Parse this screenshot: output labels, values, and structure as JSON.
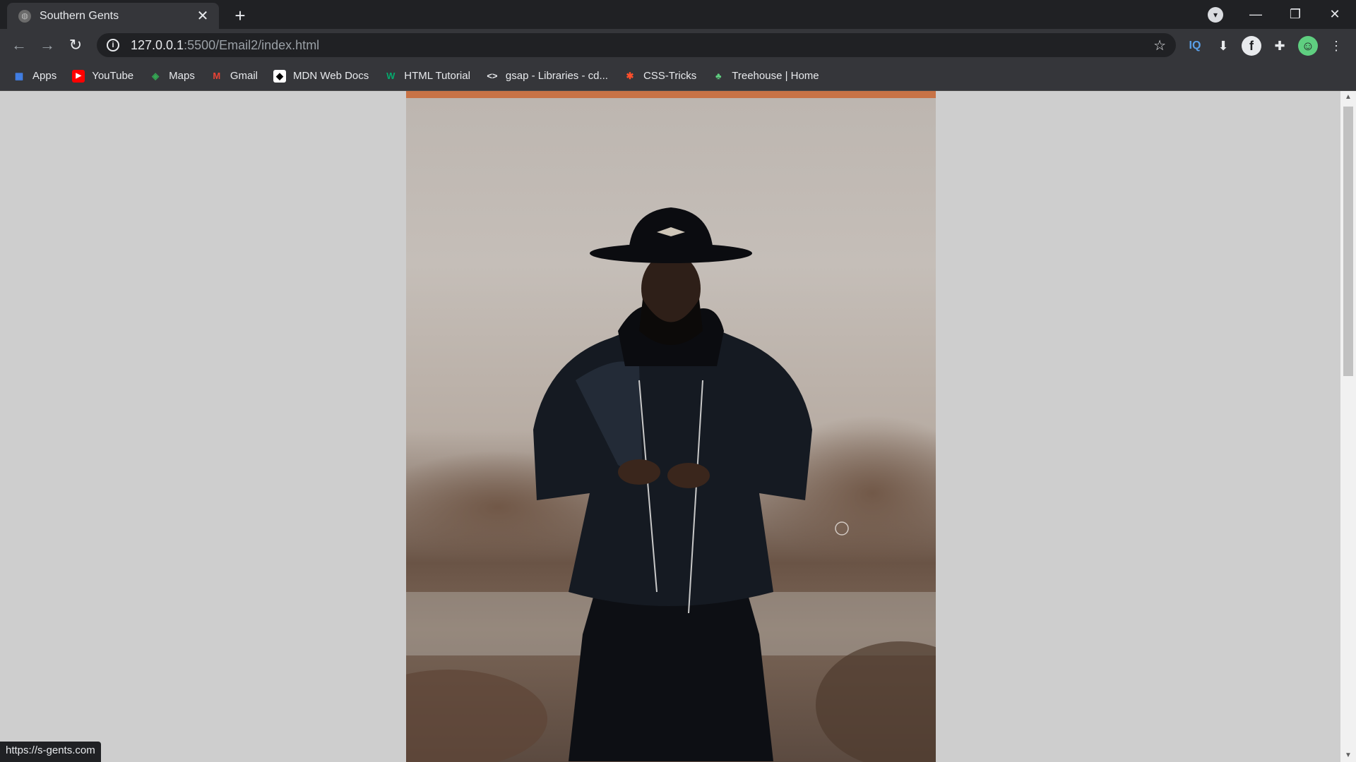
{
  "tab": {
    "title": "Southern Gents",
    "close": "✕"
  },
  "new_tab": "+",
  "window": {
    "minimize": "—",
    "restore": "❐",
    "close": "✕"
  },
  "nav": {
    "back": "←",
    "forward": "→",
    "reload": "↻"
  },
  "address": {
    "host": "127.0.0.1",
    "path": ":5500/Email2/index.html"
  },
  "extensions": {
    "iq": "IQ"
  },
  "bookmarks": [
    {
      "label": "Apps",
      "icon": "apps-grid-icon",
      "color": "#4285f4"
    },
    {
      "label": "YouTube",
      "icon": "youtube-icon",
      "color": "#ff0000"
    },
    {
      "label": "Maps",
      "icon": "maps-icon",
      "color": "#34a853"
    },
    {
      "label": "Gmail",
      "icon": "gmail-icon",
      "color": "#ea4335"
    },
    {
      "label": "MDN Web Docs",
      "icon": "mdn-icon",
      "color": "#ffffff"
    },
    {
      "label": "HTML Tutorial",
      "icon": "w3schools-icon",
      "color": "#04aa6d"
    },
    {
      "label": "gsap - Libraries - cd...",
      "icon": "code-brackets-icon",
      "color": "#e8eaed"
    },
    {
      "label": "CSS-Tricks",
      "icon": "css-tricks-icon",
      "color": "#ff4f2b"
    },
    {
      "label": "Treehouse | Home",
      "icon": "treehouse-icon",
      "color": "#5fcf80"
    }
  ],
  "status_url": "https://s-gents.com",
  "colors": {
    "accent_bar": "#c87346",
    "page_bg": "#cecece",
    "chrome_dark": "#202124",
    "chrome_toolbar": "#35363a"
  }
}
